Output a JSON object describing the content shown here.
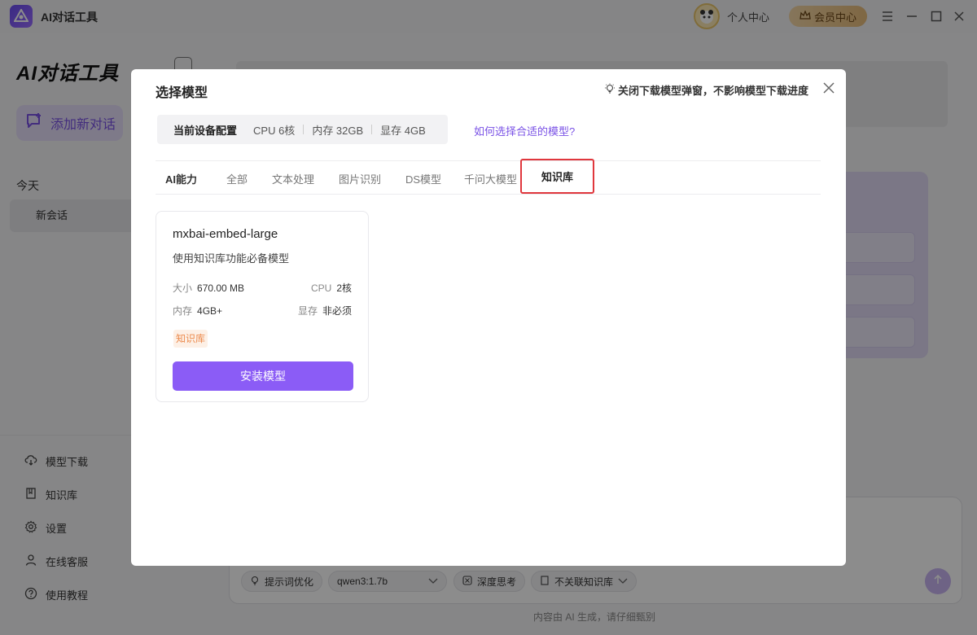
{
  "app": {
    "title": "AI对话工具"
  },
  "titlebar": {
    "personal_center": "个人中心",
    "vip_center": "会员中心"
  },
  "sidebar": {
    "brand": "AI对话工具",
    "new_chat": "添加新对话",
    "today": "今天",
    "session": "新会话",
    "menu": [
      {
        "label": "模型下载",
        "icon": "cloud-download-icon"
      },
      {
        "label": "知识库",
        "icon": "book-icon"
      },
      {
        "label": "设置",
        "icon": "gear-icon"
      },
      {
        "label": "在线客服",
        "icon": "user-icon"
      },
      {
        "label": "使用教程",
        "icon": "help-icon"
      }
    ]
  },
  "composer": {
    "prompt_optimize": "提示词优化",
    "model_select": "qwen3:1.7b",
    "deep_think": "深度思考",
    "kb_select": "不关联知识库",
    "footer": "内容由 AI 生成，请仔细甄别"
  },
  "modal": {
    "title": "选择模型",
    "close_download_popup": "关闭下载模型弹窗，不影响模型下载进度",
    "device": {
      "label": "当前设备配置",
      "cpu": "CPU 6核",
      "memory": "内存 32GB",
      "vram": "显存 4GB"
    },
    "help_link": "如何选择合适的模型?",
    "tabs": {
      "lead": "AI能力",
      "items": [
        "全部",
        "文本处理",
        "图片识别",
        "DS模型",
        "千问大模型",
        "知识库"
      ]
    },
    "card": {
      "name": "mxbai-embed-large",
      "desc": "使用知识库功能必备模型",
      "size_key": "大小",
      "size_val": "670.00 MB",
      "cpu_key": "CPU",
      "cpu_val": "2核",
      "mem_key": "内存",
      "mem_val": "4GB+",
      "vram_key": "显存",
      "vram_val": "非必须",
      "tag": "知识库",
      "install": "安装模型"
    }
  },
  "colors": {
    "accent": "#8b5cf6",
    "highlight": "#e0373d",
    "tag": "#ec8a4d"
  }
}
